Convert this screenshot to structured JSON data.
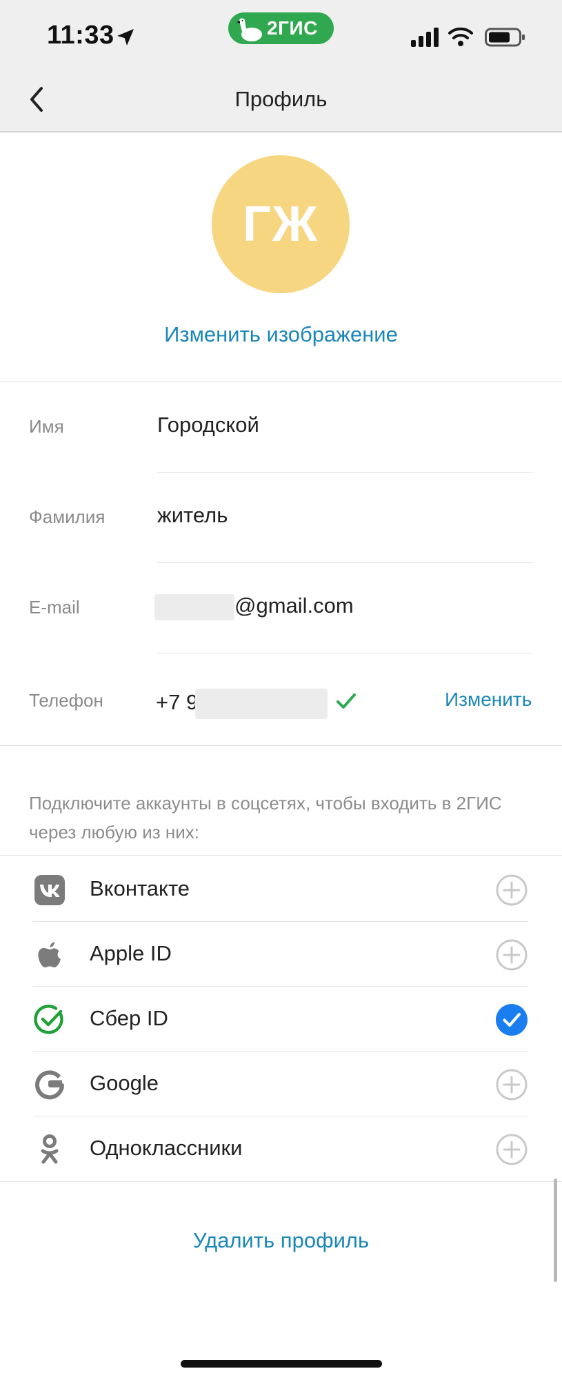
{
  "status_bar": {
    "time": "11:33",
    "brand_badge": "2ГИС",
    "brand_color": "#2fa84f"
  },
  "nav": {
    "title": "Профиль",
    "back_icon": "chevron-left-icon"
  },
  "avatar": {
    "initials": "ГЖ",
    "color": "#f7d681",
    "change_label": "Изменить изображение"
  },
  "form": {
    "first_name": {
      "label": "Имя",
      "value": "Городской"
    },
    "last_name": {
      "label": "Фамилия",
      "value": "житель"
    },
    "email": {
      "label": "E-mail",
      "value_suffix": "@gmail.com"
    },
    "phone": {
      "label": "Телефон",
      "value_prefix": "+7 9",
      "verified": true,
      "change_label": "Изменить"
    }
  },
  "social": {
    "hint": "Подключите аккаунты в соцсетях, чтобы входить в 2ГИС через любую из них:",
    "items": [
      {
        "label": "Вконтакте",
        "icon": "vk-icon",
        "connected": false
      },
      {
        "label": "Apple ID",
        "icon": "apple-icon",
        "connected": false
      },
      {
        "label": "Сбер ID",
        "icon": "sber-icon",
        "connected": true
      },
      {
        "label": "Google",
        "icon": "google-icon",
        "connected": false
      },
      {
        "label": "Одноклассники",
        "icon": "ok-icon",
        "connected": false
      }
    ]
  },
  "delete_label": "Удалить профиль",
  "colors": {
    "link": "#1b87b8",
    "check_green": "#2fa84f",
    "connected_blue": "#1a7ef0"
  }
}
